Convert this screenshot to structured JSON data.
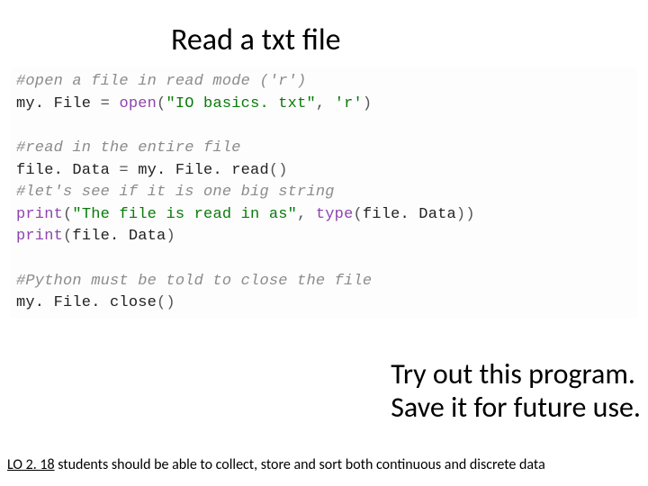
{
  "title": "Read a txt file",
  "code": {
    "c1": "#open a file in read mode ('r')",
    "l2_ident": "my. File ",
    "l2_eq": "= ",
    "l2_open": "open",
    "l2_p1": "(",
    "l2_s1": "\"IO basics. txt\"",
    "l2_comma": ", ",
    "l2_s2": "'r'",
    "l2_p2": ")",
    "c3": "#read in the entire file",
    "l4_ident": "file. Data ",
    "l4_eq": "= ",
    "l4_rhs1": "my. File. read",
    "l4_p": "()",
    "c5": "#let's see if it is one big string",
    "l6_print": "print",
    "l6_p1": "(",
    "l6_s": "\"The file is read in as\"",
    "l6_comma": ", ",
    "l6_type": "type",
    "l6_p2": "(",
    "l6_arg": "file. Data",
    "l6_p3": "))",
    "l7_print": "print",
    "l7_p1": "(",
    "l7_arg": "file. Data",
    "l7_p2": ")",
    "c8": "#Python must be told to close the file",
    "l9_ident": "my. File. close",
    "l9_p": "()"
  },
  "callout": {
    "line1": "Try out this program.",
    "line2": "Save it for future use."
  },
  "footer": {
    "lo": "LO 2. 18",
    "rest": " students should be able to collect, store and sort both continuous and discrete data"
  }
}
